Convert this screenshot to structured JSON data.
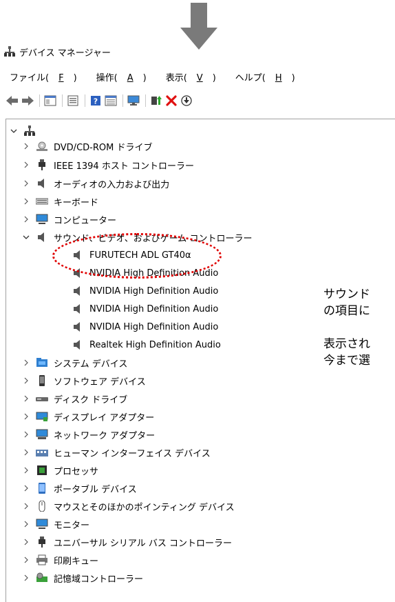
{
  "window": {
    "title": "デバイス マネージャー"
  },
  "menu": [
    {
      "label": "ファイル(",
      "key": "F",
      "close": ")"
    },
    {
      "label": "操作(",
      "key": "A",
      "close": ")"
    },
    {
      "label": "表示(",
      "key": "V",
      "close": ")"
    },
    {
      "label": "ヘルプ(",
      "key": "H",
      "close": ")"
    }
  ],
  "tree": {
    "root": "",
    "categories": [
      "DVD/CD-ROM ドライブ",
      "IEEE 1394 ホスト コントローラー",
      "オーディオの入力および出力",
      "キーボード",
      "コンピューター",
      "サウンド、ビデオ、およびゲーム コントローラー",
      "システム デバイス",
      "ソフトウェア デバイス",
      "ディスク ドライブ",
      "ディスプレイ アダプター",
      "ネットワーク アダプター",
      "ヒューマン インターフェイス デバイス",
      "プロセッサ",
      "ポータブル デバイス",
      "マウスとそのほかのポインティング デバイス",
      "モニター",
      "ユニバーサル シリアル バス コントローラー",
      "印刷キュー",
      "記憶域コントローラー"
    ],
    "sound_children": [
      "FURUTECH ADL GT40α",
      "NVIDIA High Definition Audio",
      "NVIDIA High Definition Audio",
      "NVIDIA High Definition Audio",
      "NVIDIA High Definition Audio",
      "Realtek High Definition Audio"
    ]
  },
  "notes": [
    "サウンド",
    "の項目に",
    "表示され",
    "今まで選"
  ],
  "colors": {
    "highlight": "#e00000",
    "arrow": "#7a7a7a"
  }
}
